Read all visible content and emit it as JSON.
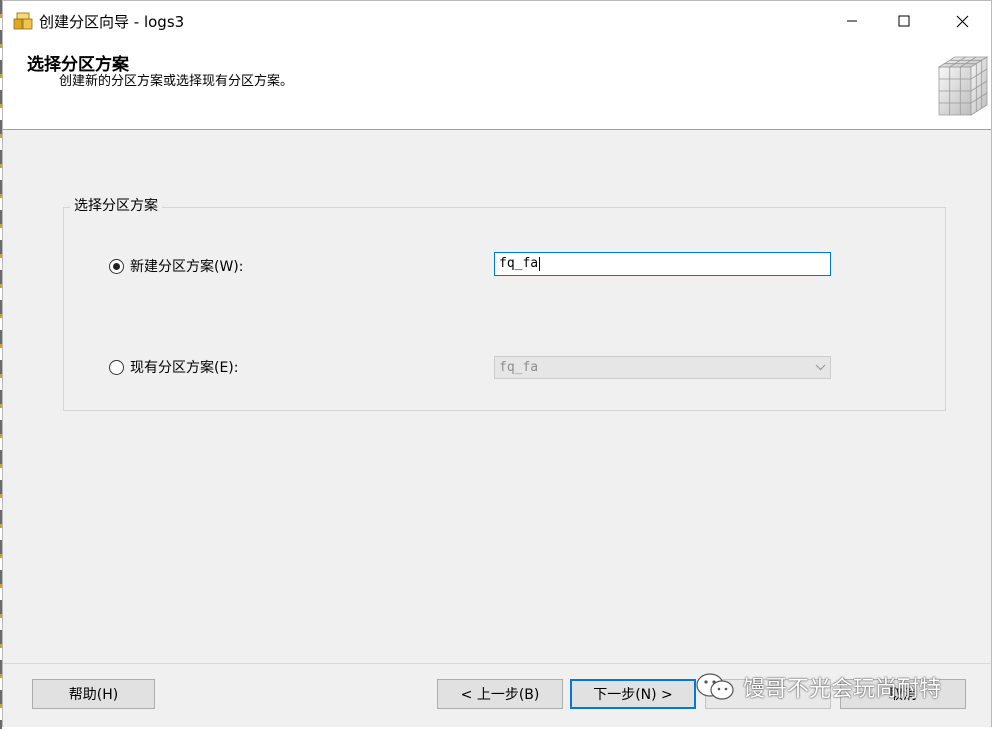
{
  "window": {
    "title": "创建分区向导 - logs3",
    "minimize_icon": "minimize-icon",
    "maximize_icon": "maximize-icon",
    "close_icon": "close-icon"
  },
  "header": {
    "title": "选择分区方案",
    "subtitle": "创建新的分区方案或选择现有分区方案。",
    "graphic_icon": "cube-grid-icon"
  },
  "group": {
    "legend": "选择分区方案",
    "new_scheme": {
      "label": "新建分区方案(W):",
      "selected": true,
      "input_value": "fq_fa"
    },
    "existing_scheme": {
      "label": "现有分区方案(E):",
      "selected": false,
      "select_value": "fq_fa",
      "disabled": true
    }
  },
  "footer": {
    "help_label": "帮助(H)",
    "back_label": "< 上一步(B)",
    "next_label": "下一步(N) >",
    "cancel_label": "取消"
  },
  "watermark": {
    "text": "馒哥不光会玩尚耐特",
    "icon": "wechat-icon"
  },
  "colors": {
    "accent": "#0078d7",
    "panel_bg": "#f0f0f0",
    "button_bg": "#e1e1e1"
  }
}
